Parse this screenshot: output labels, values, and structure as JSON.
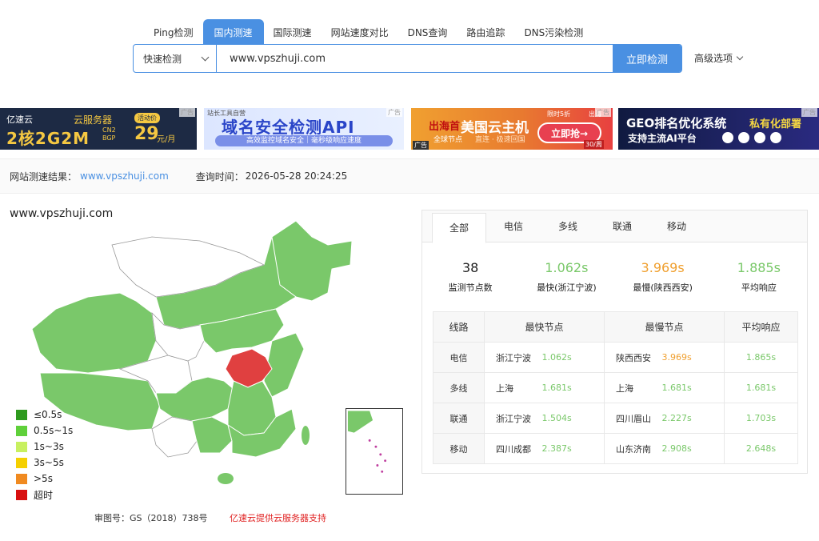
{
  "tabs": [
    "Ping检测",
    "国内测速",
    "国际测速",
    "网站速度对比",
    "DNS查询",
    "路由追踪",
    "DNS污染检测"
  ],
  "active_tab": 1,
  "search": {
    "mode": "快速检测",
    "url": "www.vpszhuji.com",
    "button": "立即检测",
    "advanced": "高级选项"
  },
  "ads": {
    "ad1": {
      "brand": "亿速云",
      "service": "云服务器",
      "promo": "活动价",
      "spec": "2核2G2M",
      "spec2": "CN2 BGP",
      "price": "29",
      "unit": "元/月"
    },
    "ad2": {
      "small": "站长工具自营",
      "title": "域名安全检测API",
      "sub": "高效监控域名安全｜毫秒级响应速度"
    },
    "ad3": {
      "t1": "出海首",
      "t2": "美国云主机",
      "t3": "全球节点",
      "t4": "直连 · 极速回国",
      "cta": "立即抢→",
      "limit": "限时5折",
      "sea": "出海",
      "count": "30/周",
      "tag": "广告"
    },
    "ad4": {
      "t1": "GEO排名优化系统",
      "t2": "私有化部署",
      "t3": "支持主流AI平台"
    },
    "tag": "广告"
  },
  "result": {
    "label": "网站测速结果：",
    "site": "www.vpszhuji.com",
    "time_label": "查询时间：",
    "time": "2026-05-28 20:24:25"
  },
  "map": {
    "title": "www.vpszhuji.com",
    "legend": [
      {
        "label": "≤0.5s",
        "color": "#2e9a1e"
      },
      {
        "label": "0.5s~1s",
        "color": "#5fd03a"
      },
      {
        "label": "1s~3s",
        "color": "#c8f060"
      },
      {
        "label": "3s~5s",
        "color": "#f5d000"
      },
      {
        "label": ">5s",
        "color": "#f08a20"
      },
      {
        "label": "超时",
        "color": "#d81010"
      }
    ],
    "approval": "审图号：GS（2018）738号",
    "support": "亿速云提供云服务器支持"
  },
  "panel": {
    "tabs": [
      "全部",
      "电信",
      "多线",
      "联通",
      "移动"
    ],
    "active_tab": 0,
    "stats": [
      {
        "value": "38",
        "caption": "监测节点数",
        "tone": "dark"
      },
      {
        "value": "1.062s",
        "caption": "最快(浙江宁波)",
        "tone": "green"
      },
      {
        "value": "3.969s",
        "caption": "最慢(陕西西安)",
        "tone": "orange"
      },
      {
        "value": "1.885s",
        "caption": "平均响应",
        "tone": "green"
      }
    ],
    "table": {
      "headers": [
        "线路",
        "最快节点",
        "最慢节点",
        "平均响应"
      ],
      "rows": [
        {
          "line": "电信",
          "fast_node": "浙江宁波",
          "fast_time": "1.062s",
          "slow_node": "陕西西安",
          "slow_time": "3.969s",
          "slow_tone": "orange",
          "avg": "1.865s"
        },
        {
          "line": "多线",
          "fast_node": "上海",
          "fast_time": "1.681s",
          "slow_node": "上海",
          "slow_time": "1.681s",
          "slow_tone": "green",
          "avg": "1.681s"
        },
        {
          "line": "联通",
          "fast_node": "浙江宁波",
          "fast_time": "1.504s",
          "slow_node": "四川眉山",
          "slow_time": "2.227s",
          "slow_tone": "green",
          "avg": "1.703s"
        },
        {
          "line": "移动",
          "fast_node": "四川成都",
          "fast_time": "2.387s",
          "slow_node": "山东济南",
          "slow_time": "2.908s",
          "slow_tone": "green",
          "avg": "2.648s"
        }
      ]
    }
  },
  "colors": {
    "accent": "#4a90e2",
    "green_fill": "#7ac86a",
    "red_fill": "#e04040",
    "orange_text": "#f0a030"
  }
}
